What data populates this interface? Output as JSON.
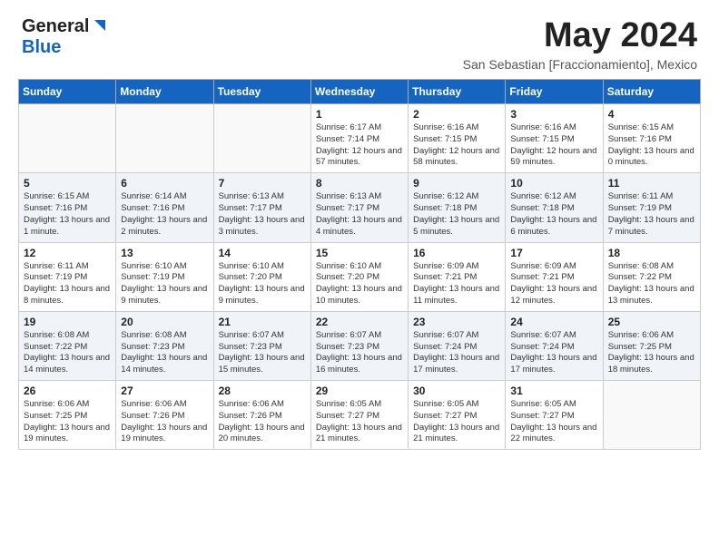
{
  "header": {
    "logo_general": "General",
    "logo_blue": "Blue",
    "title": "May 2024",
    "subtitle": "San Sebastian [Fraccionamiento], Mexico"
  },
  "days_of_week": [
    "Sunday",
    "Monday",
    "Tuesday",
    "Wednesday",
    "Thursday",
    "Friday",
    "Saturday"
  ],
  "weeks": [
    [
      {
        "day": "",
        "info": ""
      },
      {
        "day": "",
        "info": ""
      },
      {
        "day": "",
        "info": ""
      },
      {
        "day": "1",
        "info": "Sunrise: 6:17 AM\nSunset: 7:14 PM\nDaylight: 12 hours and 57 minutes."
      },
      {
        "day": "2",
        "info": "Sunrise: 6:16 AM\nSunset: 7:15 PM\nDaylight: 12 hours and 58 minutes."
      },
      {
        "day": "3",
        "info": "Sunrise: 6:16 AM\nSunset: 7:15 PM\nDaylight: 12 hours and 59 minutes."
      },
      {
        "day": "4",
        "info": "Sunrise: 6:15 AM\nSunset: 7:16 PM\nDaylight: 13 hours and 0 minutes."
      }
    ],
    [
      {
        "day": "5",
        "info": "Sunrise: 6:15 AM\nSunset: 7:16 PM\nDaylight: 13 hours and 1 minute."
      },
      {
        "day": "6",
        "info": "Sunrise: 6:14 AM\nSunset: 7:16 PM\nDaylight: 13 hours and 2 minutes."
      },
      {
        "day": "7",
        "info": "Sunrise: 6:13 AM\nSunset: 7:17 PM\nDaylight: 13 hours and 3 minutes."
      },
      {
        "day": "8",
        "info": "Sunrise: 6:13 AM\nSunset: 7:17 PM\nDaylight: 13 hours and 4 minutes."
      },
      {
        "day": "9",
        "info": "Sunrise: 6:12 AM\nSunset: 7:18 PM\nDaylight: 13 hours and 5 minutes."
      },
      {
        "day": "10",
        "info": "Sunrise: 6:12 AM\nSunset: 7:18 PM\nDaylight: 13 hours and 6 minutes."
      },
      {
        "day": "11",
        "info": "Sunrise: 6:11 AM\nSunset: 7:19 PM\nDaylight: 13 hours and 7 minutes."
      }
    ],
    [
      {
        "day": "12",
        "info": "Sunrise: 6:11 AM\nSunset: 7:19 PM\nDaylight: 13 hours and 8 minutes."
      },
      {
        "day": "13",
        "info": "Sunrise: 6:10 AM\nSunset: 7:19 PM\nDaylight: 13 hours and 9 minutes."
      },
      {
        "day": "14",
        "info": "Sunrise: 6:10 AM\nSunset: 7:20 PM\nDaylight: 13 hours and 9 minutes."
      },
      {
        "day": "15",
        "info": "Sunrise: 6:10 AM\nSunset: 7:20 PM\nDaylight: 13 hours and 10 minutes."
      },
      {
        "day": "16",
        "info": "Sunrise: 6:09 AM\nSunset: 7:21 PM\nDaylight: 13 hours and 11 minutes."
      },
      {
        "day": "17",
        "info": "Sunrise: 6:09 AM\nSunset: 7:21 PM\nDaylight: 13 hours and 12 minutes."
      },
      {
        "day": "18",
        "info": "Sunrise: 6:08 AM\nSunset: 7:22 PM\nDaylight: 13 hours and 13 minutes."
      }
    ],
    [
      {
        "day": "19",
        "info": "Sunrise: 6:08 AM\nSunset: 7:22 PM\nDaylight: 13 hours and 14 minutes."
      },
      {
        "day": "20",
        "info": "Sunrise: 6:08 AM\nSunset: 7:23 PM\nDaylight: 13 hours and 14 minutes."
      },
      {
        "day": "21",
        "info": "Sunrise: 6:07 AM\nSunset: 7:23 PM\nDaylight: 13 hours and 15 minutes."
      },
      {
        "day": "22",
        "info": "Sunrise: 6:07 AM\nSunset: 7:23 PM\nDaylight: 13 hours and 16 minutes."
      },
      {
        "day": "23",
        "info": "Sunrise: 6:07 AM\nSunset: 7:24 PM\nDaylight: 13 hours and 17 minutes."
      },
      {
        "day": "24",
        "info": "Sunrise: 6:07 AM\nSunset: 7:24 PM\nDaylight: 13 hours and 17 minutes."
      },
      {
        "day": "25",
        "info": "Sunrise: 6:06 AM\nSunset: 7:25 PM\nDaylight: 13 hours and 18 minutes."
      }
    ],
    [
      {
        "day": "26",
        "info": "Sunrise: 6:06 AM\nSunset: 7:25 PM\nDaylight: 13 hours and 19 minutes."
      },
      {
        "day": "27",
        "info": "Sunrise: 6:06 AM\nSunset: 7:26 PM\nDaylight: 13 hours and 19 minutes."
      },
      {
        "day": "28",
        "info": "Sunrise: 6:06 AM\nSunset: 7:26 PM\nDaylight: 13 hours and 20 minutes."
      },
      {
        "day": "29",
        "info": "Sunrise: 6:05 AM\nSunset: 7:27 PM\nDaylight: 13 hours and 21 minutes."
      },
      {
        "day": "30",
        "info": "Sunrise: 6:05 AM\nSunset: 7:27 PM\nDaylight: 13 hours and 21 minutes."
      },
      {
        "day": "31",
        "info": "Sunrise: 6:05 AM\nSunset: 7:27 PM\nDaylight: 13 hours and 22 minutes."
      },
      {
        "day": "",
        "info": ""
      }
    ]
  ]
}
